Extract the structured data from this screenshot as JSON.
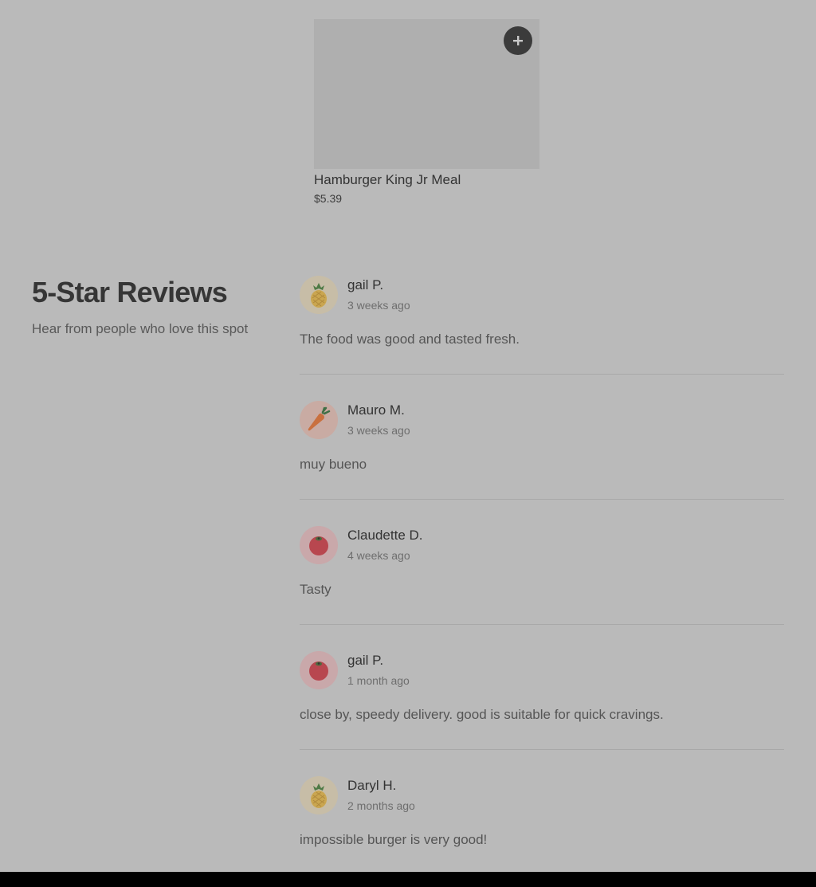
{
  "product": {
    "name": "Hamburger King Jr Meal",
    "price": "$5.39",
    "add_icon": "plus-icon"
  },
  "reviews_section": {
    "title": "5-Star Reviews",
    "subtitle": "Hear from people who love this spot"
  },
  "reviews": [
    {
      "name": "gail P.",
      "date": "3 weeks ago",
      "text": "The food was good and tasted fresh.",
      "avatar": "pineapple-icon"
    },
    {
      "name": "Mauro M.",
      "date": "3 weeks ago",
      "text": "muy bueno",
      "avatar": "carrot-icon"
    },
    {
      "name": "Claudette D.",
      "date": "4 weeks ago",
      "text": "Tasty",
      "avatar": "tomato-icon"
    },
    {
      "name": "gail P.",
      "date": "1 month ago",
      "text": "close by, speedy delivery. good is suitable for quick cravings.",
      "avatar": "tomato-icon"
    },
    {
      "name": "Daryl H.",
      "date": "2 months ago",
      "text": "impossible burger is very good!",
      "avatar": "pineapple-icon"
    }
  ],
  "colors": {
    "overlay_background": "#bababa",
    "add_button": "#3b3b3b",
    "bottom_bar": "#000000"
  }
}
